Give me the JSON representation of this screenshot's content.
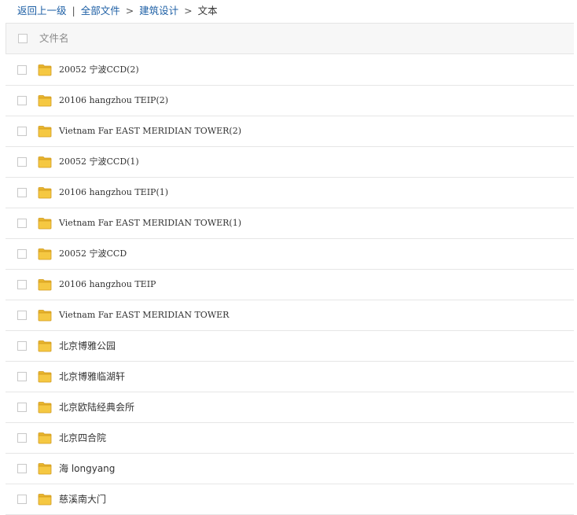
{
  "breadcrumb": {
    "back": "返回上一级",
    "divider": "|",
    "all_files": "全部文件",
    "sep": ">",
    "folder": "建筑设计",
    "current": "文本"
  },
  "header": {
    "column_name": "文件名"
  },
  "files": [
    {
      "name": "20052 宁波CCD(2)",
      "type": "folder"
    },
    {
      "name": "20106 hangzhou TEIP(2)",
      "type": "folder"
    },
    {
      "name": "Vietnam Far EAST MERIDIAN TOWER(2)",
      "type": "folder"
    },
    {
      "name": "20052 宁波CCD(1)",
      "type": "folder"
    },
    {
      "name": "20106 hangzhou TEIP(1)",
      "type": "folder"
    },
    {
      "name": "Vietnam Far EAST MERIDIAN TOWER(1)",
      "type": "folder"
    },
    {
      "name": "20052 宁波CCD",
      "type": "folder"
    },
    {
      "name": "20106 hangzhou TEIP",
      "type": "folder"
    },
    {
      "name": "Vietnam Far EAST MERIDIAN TOWER",
      "type": "folder"
    },
    {
      "name": "北京博雅公园",
      "type": "folder"
    },
    {
      "name": "北京博雅临湖轩",
      "type": "folder"
    },
    {
      "name": "北京欧陆经典会所",
      "type": "folder"
    },
    {
      "name": "北京四合院",
      "type": "folder"
    },
    {
      "name": "海 longyang",
      "type": "folder"
    },
    {
      "name": "慈溪南大门",
      "type": "folder"
    }
  ],
  "colors": {
    "link": "#1d5fa5",
    "folder_fill": "#f5c842",
    "folder_tab": "#e8b52c",
    "folder_stroke": "#d19a1e"
  }
}
